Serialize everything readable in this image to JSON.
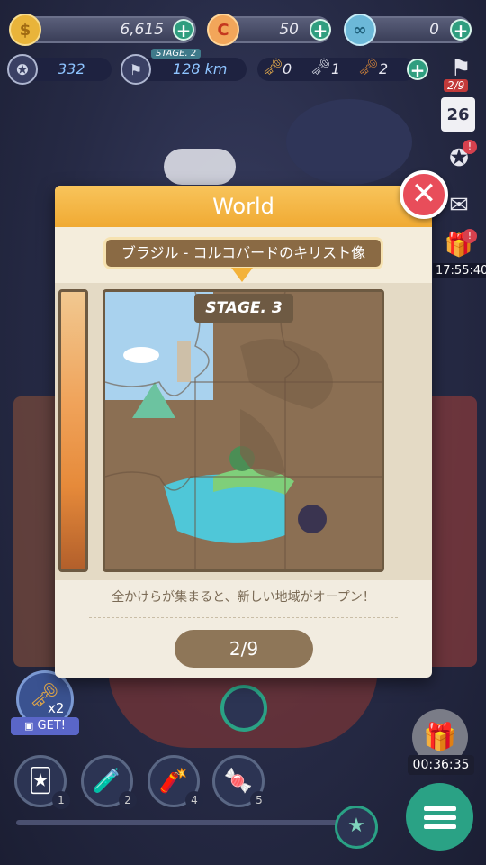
{
  "currencies": {
    "gold": {
      "value": "6,615"
    },
    "gem": {
      "value": "50"
    },
    "infinity": {
      "value": "0"
    }
  },
  "stats": {
    "points": "332",
    "stage_tag": "STAGE. 2",
    "distance": "128 km",
    "keys": [
      {
        "color": "gold",
        "count": "0"
      },
      {
        "color": "silver",
        "count": "1"
      },
      {
        "color": "bronze",
        "count": "2"
      }
    ]
  },
  "side": {
    "flag_badge": "2/9",
    "calendar_day": "26",
    "gift_time": "17:55:40"
  },
  "modal": {
    "title": "World",
    "subtitle": "ブラジル - コルコバードのキリスト像",
    "stage": "STAGE. 3",
    "hint": "全かけらが集まると、新しい地域がオープン！",
    "progress": "2/9",
    "close_glyph": "✕"
  },
  "bottom": {
    "key_multiplier": "x2",
    "get_label": "GET!",
    "items": [
      {
        "icon": "card-icon",
        "count": "1"
      },
      {
        "icon": "potion-icon",
        "count": "2"
      },
      {
        "icon": "dynamite-icon",
        "count": "4"
      },
      {
        "icon": "candy-icon",
        "count": "5"
      }
    ],
    "gift_timer": "00:36:35"
  },
  "colors": {
    "accent_green": "#2aa285",
    "modal_header": "#f0aa33",
    "close_red": "#e84d5a"
  }
}
